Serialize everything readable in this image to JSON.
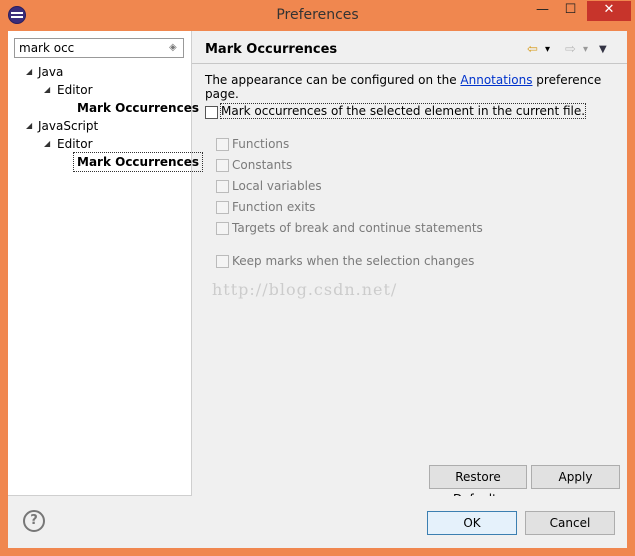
{
  "window": {
    "title": "Preferences",
    "close_glyph": "✕",
    "minimize_glyph": "—",
    "maximize_glyph": "☐"
  },
  "filter": {
    "value": "mark occ",
    "clear_icon": "eraser-icon"
  },
  "tree": [
    {
      "label": "Java",
      "twisty": "◢"
    },
    {
      "label": "Editor",
      "twisty": "◢"
    },
    {
      "label": "Mark Occurrences"
    },
    {
      "label": "JavaScript",
      "twisty": "◢"
    },
    {
      "label": "Editor",
      "twisty": "◢"
    },
    {
      "label": "Mark Occurrences"
    }
  ],
  "page": {
    "title": "Mark Occurrences",
    "desc_before": "The appearance can be configured on the ",
    "desc_link": "Annotations",
    "desc_after": " preference page.",
    "main_option": "Mark occurrences of the selected element in the current file.",
    "options": [
      "Functions",
      "Constants",
      "Local variables",
      "Function exits",
      "Targets of break and continue statements"
    ],
    "keep_marks": "Keep marks when the selection changes"
  },
  "nav": {
    "back_glyph": "⇦",
    "forward_glyph": "⇨",
    "dropdown_glyph": "▾",
    "menu_glyph": "▼"
  },
  "buttons": {
    "restore_defaults": "Restore Defaults",
    "apply": "Apply",
    "ok": "OK",
    "cancel": "Cancel"
  },
  "help": {
    "glyph": "?"
  },
  "watermark": "http://blog.csdn.net/"
}
